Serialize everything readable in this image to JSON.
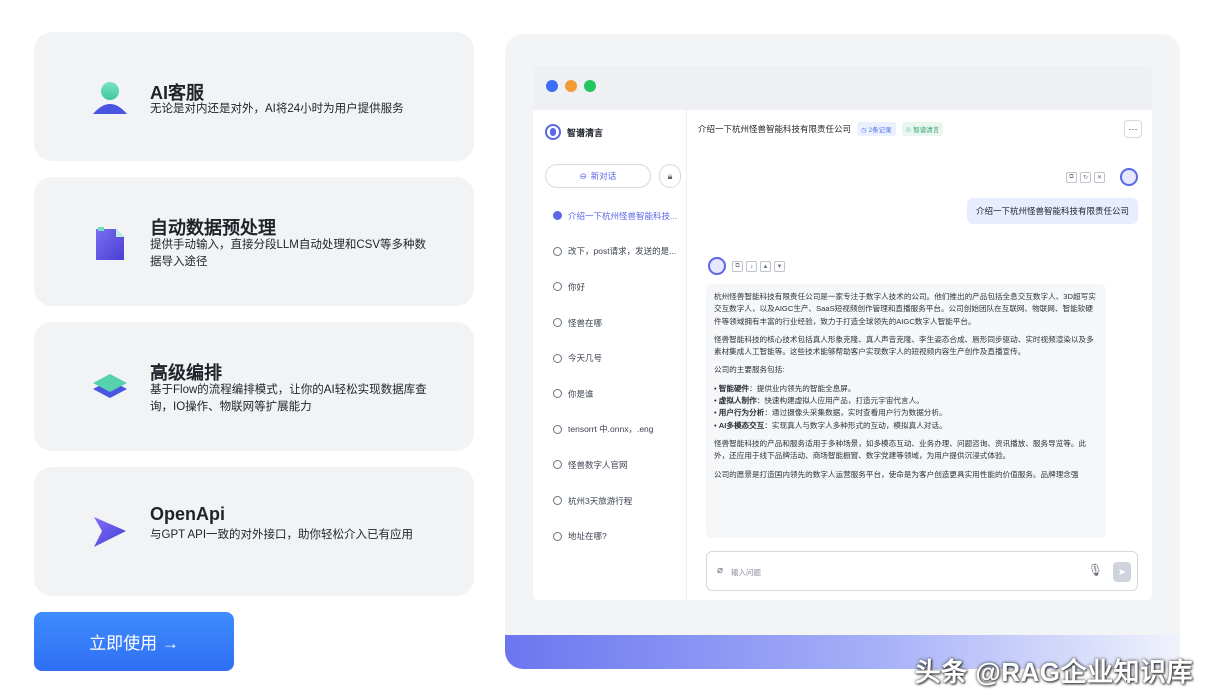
{
  "features": [
    {
      "title": "AI客服",
      "description": "无论是对内还是对外，AI将24小时为用户提供服务",
      "icon": "person-icon"
    },
    {
      "title": "自动数据预处理",
      "description": "提供手动输入，直接分段LLM自动处理和CSV等多种数据导入途径",
      "icon": "document-icon"
    },
    {
      "title": "高级编排",
      "description": "基于Flow的流程编排模式，让你的AI轻松实现数据库查询，IO操作、物联网等扩展能力",
      "icon": "layers-icon"
    },
    {
      "title": "OpenApi",
      "description": "与GPT API一致的对外接口，助你轻松介入已有应用",
      "icon": "send-arrow-icon"
    }
  ],
  "cta": {
    "label": "立即使用 →"
  },
  "preview": {
    "brand": "智谱清言",
    "new_chat": "新对话",
    "history": [
      "介绍一下杭州怪兽智能科技...",
      "改下，post请求，发送的是...",
      "你好",
      "怪兽在哪",
      "今天几号",
      "你是谁",
      "tensorrt 中.onnx，.eng",
      "怪兽数字人官网",
      "杭州3天旅游行程",
      "地址在哪?"
    ],
    "chat_title": "介绍一下杭州怪兽智能科技有限责任公司",
    "tag_records": "2条记录",
    "tag_model": "智谱清言",
    "user_message": "介绍一下杭州怪兽智能科技有限责任公司",
    "answer": {
      "p1": "杭州怪兽智能科技有限责任公司是一家专注于数字人技术的公司。他们推出的产品包括全息交互数字人、3D超写实交互数字人，以及AIGC生产、SaaS短视频创作管理和直播服务平台。公司创始团队在互联网、物联网、智能软硬件等领域拥有丰富的行业经验，致力于打造全球领先的AIGC数字人智能平台。",
      "p2": "怪兽智能科技的核心技术包括真人形象克隆、真人声音克隆、李生姿态合成、唇形同步驱动、实时视频渲染以及多素材集成人工智能等。这些技术能够帮助客户实现数字人的短视频内容生产创作及直播宣传。",
      "p3": "公司的主要服务包括:",
      "bullets": [
        {
          "k": "智能硬件",
          "v": "：提供业内领先的智能全息屏。"
        },
        {
          "k": "虚拟人制作",
          "v": "：快速构建虚拟人应用产品，打造元宇宙代言人。"
        },
        {
          "k": "用户行为分析",
          "v": "：通过摄像头采集数据，实时查看用户行为数据分析。"
        },
        {
          "k": "AI多模态交互",
          "v": "：实现真人与数字人多种形式的互动，模拟真人对话。"
        }
      ],
      "p4": "怪兽智能科技的产品和服务适用于多种场景，如多模态互动、业务办理、问题咨询、资讯播放、服务导览等。此外，还应用于线下品牌活动、商场智能橱窗、数字党建等领域，为用户提供沉浸式体验。",
      "p5": "公司的愿景是打造国内领先的数字人运营服务平台，使命是为客户创造更具实用性能的价值服务。品牌理念强"
    },
    "input_placeholder": "输入问题"
  },
  "watermark": "头条 @RAG企业知识库",
  "colors": {
    "accent": "#5b67e8",
    "cta": "#3a7ef7",
    "card_bg": "#f2f3f5"
  }
}
